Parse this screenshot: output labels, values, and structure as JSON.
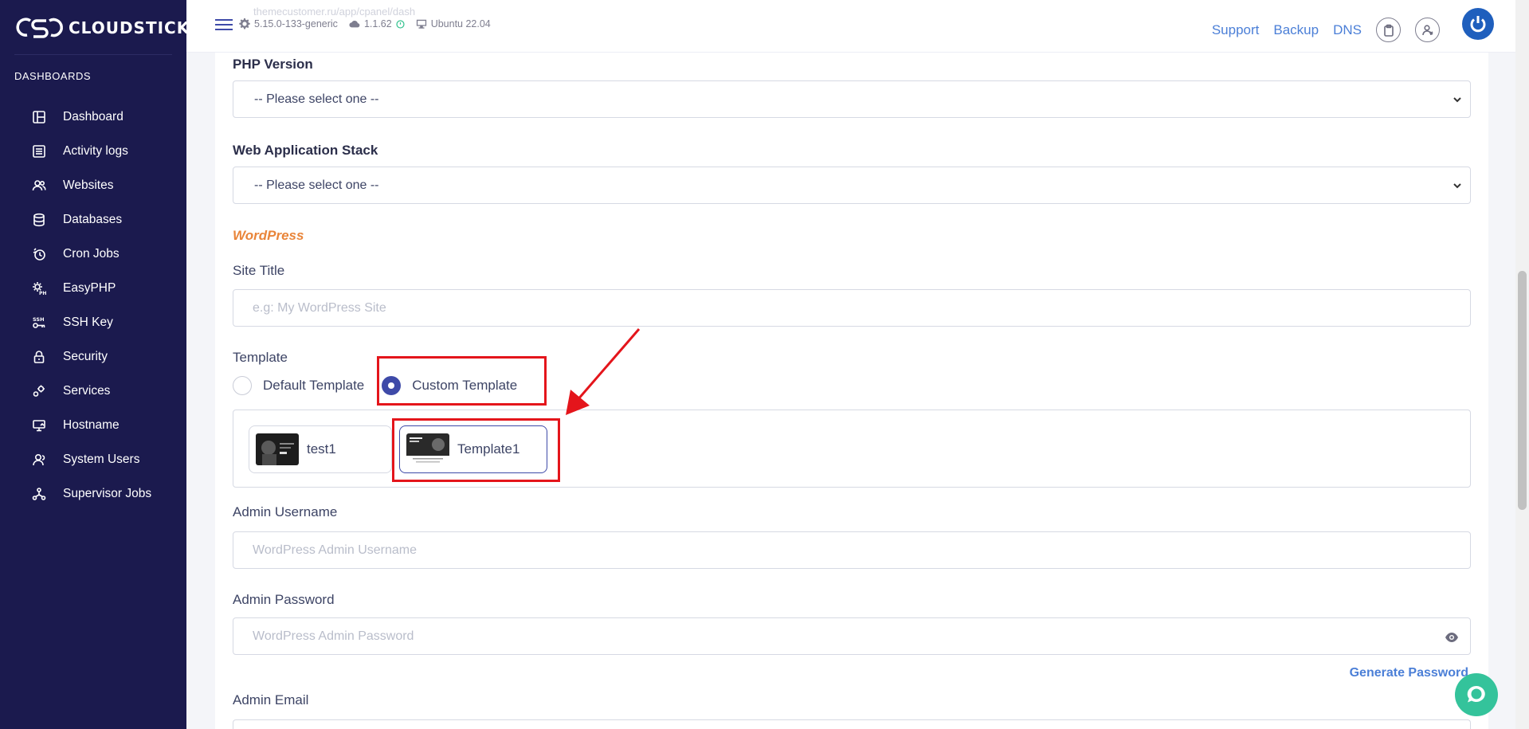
{
  "brand": {
    "name": "CLOUDSTICK"
  },
  "sidebar": {
    "section": "DASHBOARDS",
    "items": [
      {
        "label": "Dashboard",
        "icon": "layout-icon"
      },
      {
        "label": "Activity logs",
        "icon": "list-icon"
      },
      {
        "label": "Websites",
        "icon": "users-icon"
      },
      {
        "label": "Databases",
        "icon": "database-icon"
      },
      {
        "label": "Cron Jobs",
        "icon": "clock-icon"
      },
      {
        "label": "EasyPHP",
        "icon": "php-gear-icon"
      },
      {
        "label": "SSH Key",
        "icon": "ssh-key-icon"
      },
      {
        "label": "Security",
        "icon": "lock-icon"
      },
      {
        "label": "Services",
        "icon": "gears-icon"
      },
      {
        "label": "Hostname",
        "icon": "monitor-icon"
      },
      {
        "label": "System Users",
        "icon": "user-icon"
      },
      {
        "label": "Supervisor Jobs",
        "icon": "nodes-icon"
      }
    ]
  },
  "topbar": {
    "faded_url": "themecustomer.ru/app/cpanel/dash",
    "kernel": "5.15.0-133-generic",
    "agent_version": "1.1.62",
    "os": "Ubuntu 22.04",
    "links": {
      "support": "Support",
      "backup": "Backup",
      "dns": "DNS"
    }
  },
  "form": {
    "php_version": {
      "label": "PHP Version",
      "value": "-- Please select one --"
    },
    "stack": {
      "label": "Web Application Stack",
      "value": "-- Please select one --"
    },
    "section_heading": "WordPress",
    "site_title": {
      "label": "Site Title",
      "placeholder": "e.g: My WordPress Site"
    },
    "template": {
      "label": "Template",
      "options": [
        {
          "label": "Default Template",
          "checked": false
        },
        {
          "label": "Custom Template",
          "checked": true
        }
      ],
      "items": [
        {
          "label": "test1",
          "selected": false
        },
        {
          "label": "Template1",
          "selected": true
        }
      ]
    },
    "admin_username": {
      "label": "Admin Username",
      "placeholder": "WordPress Admin Username"
    },
    "admin_password": {
      "label": "Admin Password",
      "placeholder": "WordPress Admin Password"
    },
    "generate_password": "Generate Password",
    "admin_email": {
      "label": "Admin Email"
    }
  },
  "colors": {
    "sidebar_bg": "#1b1a4e",
    "accent": "#3e4aa8",
    "link": "#4b7fd7",
    "highlight": "#e4151b",
    "section": "#e9853a"
  }
}
